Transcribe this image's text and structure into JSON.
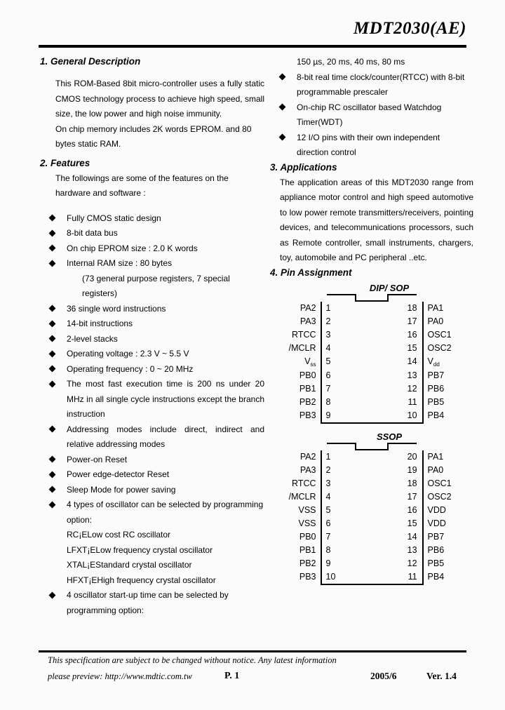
{
  "header": {
    "title": "MDT2030(AE)"
  },
  "sections": {
    "general_description": {
      "heading": "1. General Description",
      "paragraphs": [
        "This ROM-Based 8bit micro-controller uses a fully static CMOS technology process to achieve high speed, small size, the low power and high noise immunity.",
        "On chip memory includes 2K words EPROM. and 80 bytes static RAM."
      ]
    },
    "features": {
      "heading": "2. Features",
      "intro": "The followings are some of the features on the hardware and software :",
      "items": [
        "Fully CMOS static design",
        "8-bit data bus",
        "On chip EPROM size : 2.0 K words",
        "Internal RAM size : 80 bytes",
        "36 single word instructions",
        "14-bit instructions",
        "2-level stacks",
        "Operating voltage : 2.3 V ~ 5.5 V",
        "Operating frequency : 0 ~ 20 MHz",
        "The most fast execution time is 200 ns under 20 MHz in all single cycle instructions except the branch instruction",
        "Addressing modes include direct, indirect and relative addressing modes",
        "Power-on Reset",
        "Power edge-detector Reset",
        "Sleep Mode for power saving",
        "4 types of oscillator can be selected by programming option:",
        "4 oscillator start-up time can be selected by programming option:"
      ],
      "ram_subnote": "(73 general purpose registers, 7 special registers)",
      "oscillator_types": [
        "RC¡ELow cost RC oscillator",
        "LFXT¡ELow frequency crystal oscillator",
        "XTAL¡EStandard crystal oscillator",
        "HFXT¡EHigh frequency crystal oscillator"
      ],
      "startup_times": "150 µs, 20 ms, 40 ms, 80 ms",
      "items_right": [
        "8-bit real time clock/counter(RTCC) with 8-bit programmable prescaler",
        "On-chip RC oscillator based Watchdog Timer(WDT)",
        "12 I/O pins with their own independent direction control"
      ]
    },
    "applications": {
      "heading": "3. Applications",
      "paragraph": "The application areas of this MDT2030 range from appliance motor control and high speed automotive to low power remote transmitters/receivers, pointing devices, and telecommunications processors, such as Remote controller, small instruments, chargers, toy, automobile and PC peripheral ..etc."
    },
    "pin_assignment": {
      "heading": "4. Pin Assignment",
      "packages": [
        {
          "name": "DIP/ SOP",
          "pin_count": 18,
          "rows": [
            {
              "left_label": "PA2",
              "left_pin": "1",
              "right_pin": "18",
              "right_label": "PA1"
            },
            {
              "left_label": "PA3",
              "left_pin": "2",
              "right_pin": "17",
              "right_label": "PA0"
            },
            {
              "left_label": "RTCC",
              "left_pin": "3",
              "right_pin": "16",
              "right_label": "OSC1"
            },
            {
              "left_label": "/MCLR",
              "left_pin": "4",
              "right_pin": "15",
              "right_label": "OSC2"
            },
            {
              "left_label": "Vss",
              "left_pin": "5",
              "right_pin": "14",
              "right_label": "Vdd"
            },
            {
              "left_label": "PB0",
              "left_pin": "6",
              "right_pin": "13",
              "right_label": "PB7"
            },
            {
              "left_label": "PB1",
              "left_pin": "7",
              "right_pin": "12",
              "right_label": "PB6"
            },
            {
              "left_label": "PB2",
              "left_pin": "8",
              "right_pin": "11",
              "right_label": "PB5"
            },
            {
              "left_label": "PB3",
              "left_pin": "9",
              "right_pin": "10",
              "right_label": "PB4"
            }
          ]
        },
        {
          "name": "SSOP",
          "pin_count": 20,
          "rows": [
            {
              "left_label": "PA2",
              "left_pin": "1",
              "right_pin": "20",
              "right_label": "PA1"
            },
            {
              "left_label": "PA3",
              "left_pin": "2",
              "right_pin": "19",
              "right_label": "PA0"
            },
            {
              "left_label": "RTCC",
              "left_pin": "3",
              "right_pin": "18",
              "right_label": "OSC1"
            },
            {
              "left_label": "/MCLR",
              "left_pin": "4",
              "right_pin": "17",
              "right_label": "OSC2"
            },
            {
              "left_label": "VSS",
              "left_pin": "5",
              "right_pin": "16",
              "right_label": "VDD"
            },
            {
              "left_label": "VSS",
              "left_pin": "6",
              "right_pin": "15",
              "right_label": "VDD"
            },
            {
              "left_label": "PB0",
              "left_pin": "7",
              "right_pin": "14",
              "right_label": "PB7"
            },
            {
              "left_label": "PB1",
              "left_pin": "8",
              "right_pin": "13",
              "right_label": "PB6"
            },
            {
              "left_label": "PB2",
              "left_pin": "9",
              "right_pin": "12",
              "right_label": "PB5"
            },
            {
              "left_label": "PB3",
              "left_pin": "10",
              "right_pin": "11",
              "right_label": "PB4"
            }
          ]
        }
      ]
    }
  },
  "footer": {
    "disclaimer": "This specification are subject to be changed without notice. Any latest information",
    "url_line": "please preview: http://www.mdtic.com.tw",
    "page": "P. 1",
    "date": "2005/6",
    "version": "Ver. 1.4"
  }
}
